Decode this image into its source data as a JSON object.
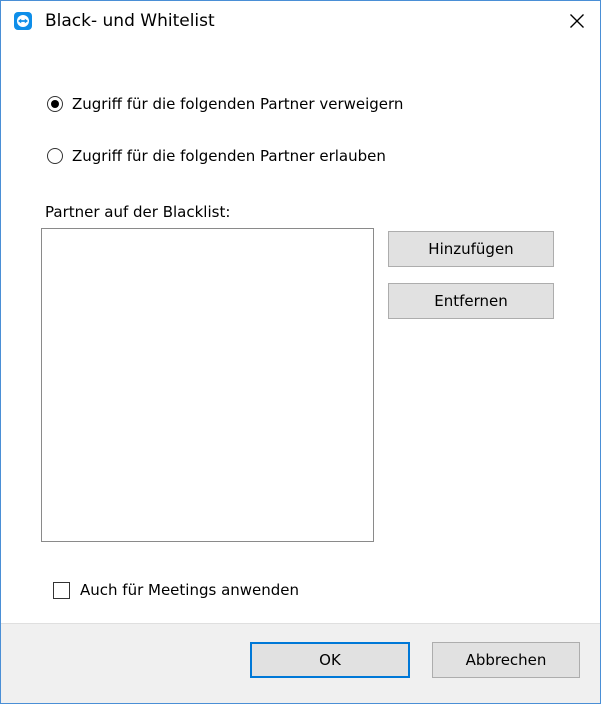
{
  "window": {
    "title": "Black- und Whitelist",
    "app_icon": "teamviewer-icon",
    "close_icon": "close-icon"
  },
  "access_mode": {
    "options": [
      {
        "label": "Zugriff für die folgenden Partner verweigern",
        "selected": true
      },
      {
        "label": "Zugriff für die folgenden Partner erlauben",
        "selected": false
      }
    ]
  },
  "partner_list": {
    "label": "Partner auf der Blacklist:",
    "items": []
  },
  "list_actions": {
    "add_label": "Hinzufügen",
    "remove_label": "Entfernen"
  },
  "meetings_option": {
    "label": "Auch für Meetings anwenden",
    "checked": false
  },
  "footer": {
    "ok_label": "OK",
    "cancel_label": "Abbrechen"
  },
  "colors": {
    "accent": "#0078d7",
    "window_border": "#4a8fd6",
    "app_icon_blue": "#0e8ee9",
    "footer_background": "#f0f0f0",
    "button_background": "#e1e1e1"
  }
}
